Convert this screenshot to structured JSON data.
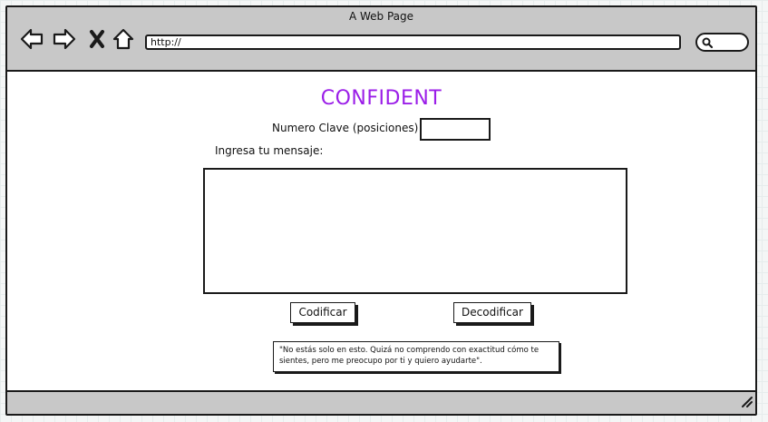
{
  "browser": {
    "title": "A Web Page",
    "url": "http://",
    "nav_icons": [
      "back-arrow-icon",
      "forward-arrow-icon",
      "close-x-icon",
      "home-icon"
    ],
    "search_icon": "search-icon"
  },
  "page": {
    "heading": "CONFIDENT",
    "heading_color": "#9b1ee8",
    "key_label": "Numero Clave (posiciones)",
    "key_value": "",
    "message_label": "Ingresa tu mensaje:",
    "message_value": "",
    "encode_button": "Codificar",
    "decode_button": "Decodificar",
    "quote": "\"No estás solo en esto. Quizá no comprendo con exactitud cómo te sientes, pero me preocupo por ti y quiero ayudarte\"."
  }
}
